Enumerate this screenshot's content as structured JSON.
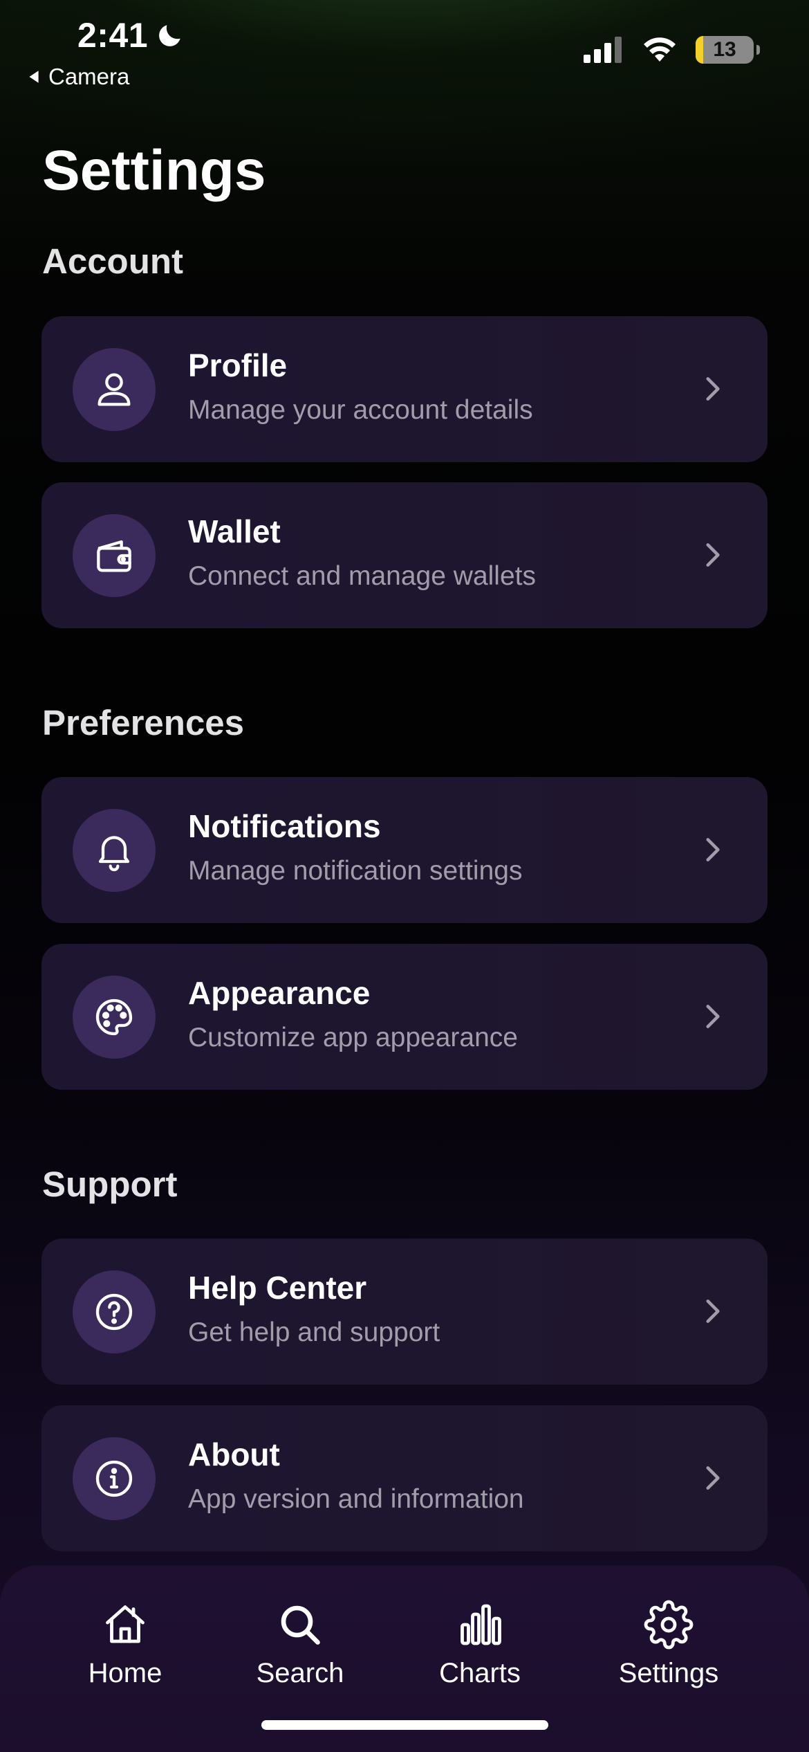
{
  "status_bar": {
    "time": "2:41",
    "back_label": "Camera",
    "battery": "13",
    "battery_level": 0.13
  },
  "page_title": "Settings",
  "sections": [
    {
      "title": "Account",
      "items": [
        {
          "icon": "user-icon",
          "title": "Profile",
          "subtitle": "Manage your account details"
        },
        {
          "icon": "wallet-icon",
          "title": "Wallet",
          "subtitle": "Connect and manage wallets"
        }
      ]
    },
    {
      "title": "Preferences",
      "items": [
        {
          "icon": "bell-icon",
          "title": "Notifications",
          "subtitle": "Manage notification settings"
        },
        {
          "icon": "palette-icon",
          "title": "Appearance",
          "subtitle": "Customize app appearance"
        }
      ]
    },
    {
      "title": "Support",
      "items": [
        {
          "icon": "question-icon",
          "title": "Help Center",
          "subtitle": "Get help and support"
        },
        {
          "icon": "info-icon",
          "title": "About",
          "subtitle": "App version and information"
        }
      ]
    }
  ],
  "tab_bar": [
    {
      "icon": "home-icon",
      "label": "Home"
    },
    {
      "icon": "search-icon",
      "label": "Search"
    },
    {
      "icon": "bar-chart-icon",
      "label": "Charts"
    },
    {
      "icon": "gear-icon",
      "label": "Settings"
    }
  ]
}
